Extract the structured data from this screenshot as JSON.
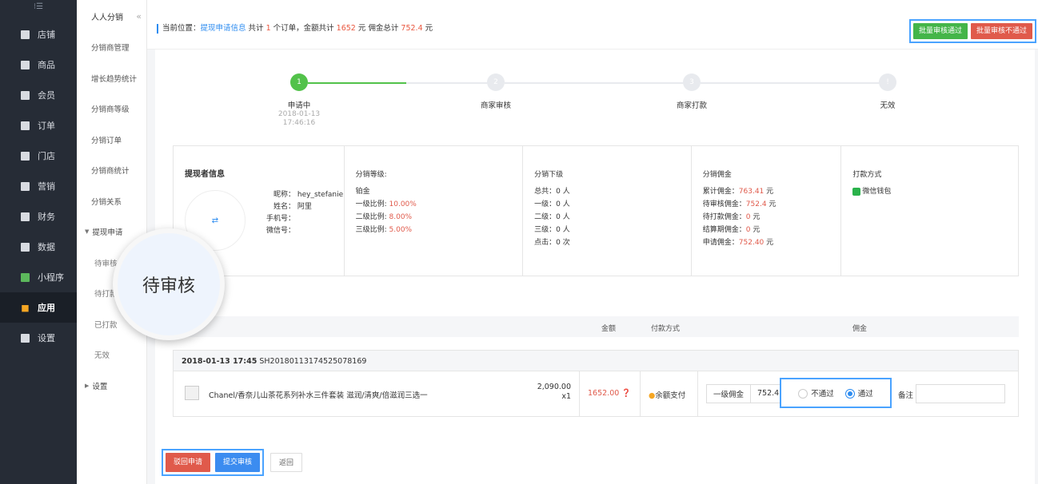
{
  "sidebar": {
    "toggle": "⁝☰",
    "items": [
      {
        "label": "店铺",
        "icon": "shop-icon"
      },
      {
        "label": "商品",
        "icon": "goods-icon"
      },
      {
        "label": "会员",
        "icon": "member-icon"
      },
      {
        "label": "订单",
        "icon": "order-icon"
      },
      {
        "label": "门店",
        "icon": "store-icon"
      },
      {
        "label": "营销",
        "icon": "marketing-icon"
      },
      {
        "label": "财务",
        "icon": "finance-icon"
      },
      {
        "label": "数据",
        "icon": "data-icon"
      },
      {
        "label": "小程序",
        "icon": "miniapp-icon"
      },
      {
        "label": "应用",
        "icon": "app-icon"
      },
      {
        "label": "设置",
        "icon": "settings-icon"
      }
    ]
  },
  "submenu": {
    "title": "人人分销",
    "collapse": "«",
    "items": [
      "分销商管理",
      "增长趋势统计",
      "分销商等级",
      "分销订单",
      "分销商统计",
      "分销关系"
    ],
    "group": "提现申请",
    "group_arrow": "▼",
    "children": [
      "待审核",
      "待打款",
      "已打款",
      "无效"
    ],
    "settings": "设置",
    "settings_arrow": "▶"
  },
  "breadcrumb": {
    "prefix": "当前位置：",
    "link": "提现申请信息",
    "t1": " 共计 ",
    "orders": "1",
    "t2": " 个订单，金额共计 ",
    "amount": "1652",
    "t3": " 元 佣金总计 ",
    "commission": "752.4",
    "t4": " 元"
  },
  "top_actions": {
    "approve": "批量审核通过",
    "reject": "批量审核不通过"
  },
  "steps": [
    {
      "num": "1",
      "label": "申请中",
      "date": "2018-01-13",
      "time": "17:46:16"
    },
    {
      "num": "2",
      "label": "商家审核"
    },
    {
      "num": "3",
      "label": "商家打款"
    },
    {
      "num": "!",
      "label": "无效"
    }
  ],
  "info": {
    "applicant_title": "提现者信息",
    "nickname_label": "昵称：",
    "nickname": "hey_stefanie",
    "name_label": "姓名：",
    "name": "阿里",
    "phone_label": "手机号：",
    "wechat_label": "微信号：",
    "level_title": "分销等级:",
    "level": "铂金",
    "rate1_label": "一级比例:",
    "rate1": "10.00%",
    "rate2_label": "二级比例:",
    "rate2": "8.00%",
    "rate3_label": "三级比例:",
    "rate3": "5.00%",
    "sub_title": "分销下级",
    "sub_total": "总共：0 人",
    "sub_l1": "一级：0 人",
    "sub_l2": "二级：0 人",
    "sub_l3": "三级：0 人",
    "clicks": "点击：0 次",
    "comm_title": "分销佣金",
    "comm_total_label": "累计佣金：",
    "comm_total": "763.41",
    "comm_pending_label": "待审核佣金：",
    "comm_pending": "752.4",
    "comm_topay_label": "待打款佣金：",
    "comm_topay": "0",
    "comm_settle_label": "结算期佣金：",
    "comm_settle": "0",
    "comm_apply_label": "申请佣金：",
    "comm_apply": "752.40",
    "unit": " 元",
    "pay_title": "打款方式",
    "pay_method": "微信钱包"
  },
  "order_table": {
    "col_amount": "金额",
    "col_pay": "付款方式",
    "col_commission": "佣金"
  },
  "order": {
    "datetime": "2018-01-13 17:45",
    "order_no": "SH20180113174525078169",
    "product": "Chanel/香奈儿山茶花系列补水三件套装 滋润/清爽/倍滋润三选一",
    "price": "2,090.00",
    "qty": "x1",
    "amount": "1652.00",
    "pay_method": "余额支付",
    "level_label": "一级佣金",
    "commission": "752.4",
    "reject": "不通过",
    "approve": "通过",
    "note": "备注"
  },
  "bottom_actions": {
    "revoke": "驳回申请",
    "submit": "提交审核",
    "back": "返回"
  },
  "magnifier": {
    "text": "待审核"
  }
}
